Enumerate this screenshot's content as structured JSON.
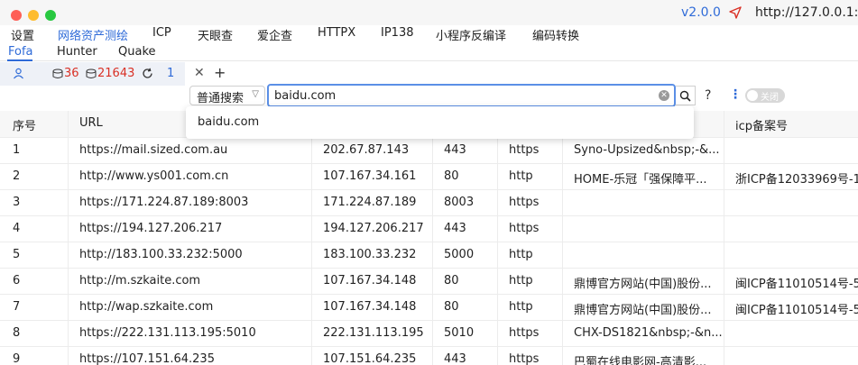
{
  "titlebar": {
    "version": "v2.0.0",
    "url_text": "http://127.0.0.1:8081"
  },
  "menu": {
    "items": [
      "设置",
      "网络资产测绘",
      "ICP",
      "天眼查",
      "爱企查",
      "HTTPX",
      "IP138",
      "小程序反编译",
      "编码转换"
    ]
  },
  "subtabs": {
    "items": [
      "Fofa",
      "Hunter",
      "Quake"
    ]
  },
  "toolbar": {
    "count_a": "36",
    "count_b": "21643",
    "tab_number": "1"
  },
  "search": {
    "mode": "普通搜索",
    "query": "baidu.com",
    "toggle_label": "关闭",
    "suggestion": "baidu.com"
  },
  "table": {
    "headers": [
      "序号",
      "URL",
      "",
      "",
      "",
      "",
      "icp备案号"
    ],
    "rows": [
      [
        "1",
        "https://mail.sized.com.au",
        "202.67.87.143",
        "443",
        "https",
        "Syno-Upsized&nbsp;-&...",
        ""
      ],
      [
        "2",
        "http://www.ys001.com.cn",
        "107.167.34.161",
        "80",
        "http",
        "HOME-乐冠「强保障平...",
        "浙ICP备12033969号-1"
      ],
      [
        "3",
        "https://171.224.87.189:8003",
        "171.224.87.189",
        "8003",
        "https",
        "",
        ""
      ],
      [
        "4",
        "https://194.127.206.217",
        "194.127.206.217",
        "443",
        "https",
        "",
        ""
      ],
      [
        "5",
        "http://183.100.33.232:5000",
        "183.100.33.232",
        "5000",
        "http",
        "",
        ""
      ],
      [
        "6",
        "http://m.szkaite.com",
        "107.167.34.148",
        "80",
        "http",
        "鼎博官方网站(中国)股份...",
        "闽ICP备11010514号-5"
      ],
      [
        "7",
        "http://wap.szkaite.com",
        "107.167.34.148",
        "80",
        "http",
        "鼎博官方网站(中国)股份...",
        "闽ICP备11010514号-5"
      ],
      [
        "8",
        "https://222.131.113.195:5010",
        "222.131.113.195",
        "5010",
        "https",
        "CHX-DS1821&nbsp;-&n...",
        ""
      ],
      [
        "9",
        "https://107.151.64.235",
        "107.151.64.235",
        "443",
        "https",
        "巴蜀在线电影网-高清影...",
        ""
      ]
    ]
  },
  "colors": {
    "accent": "#2f6bd8",
    "danger": "#d93025"
  }
}
